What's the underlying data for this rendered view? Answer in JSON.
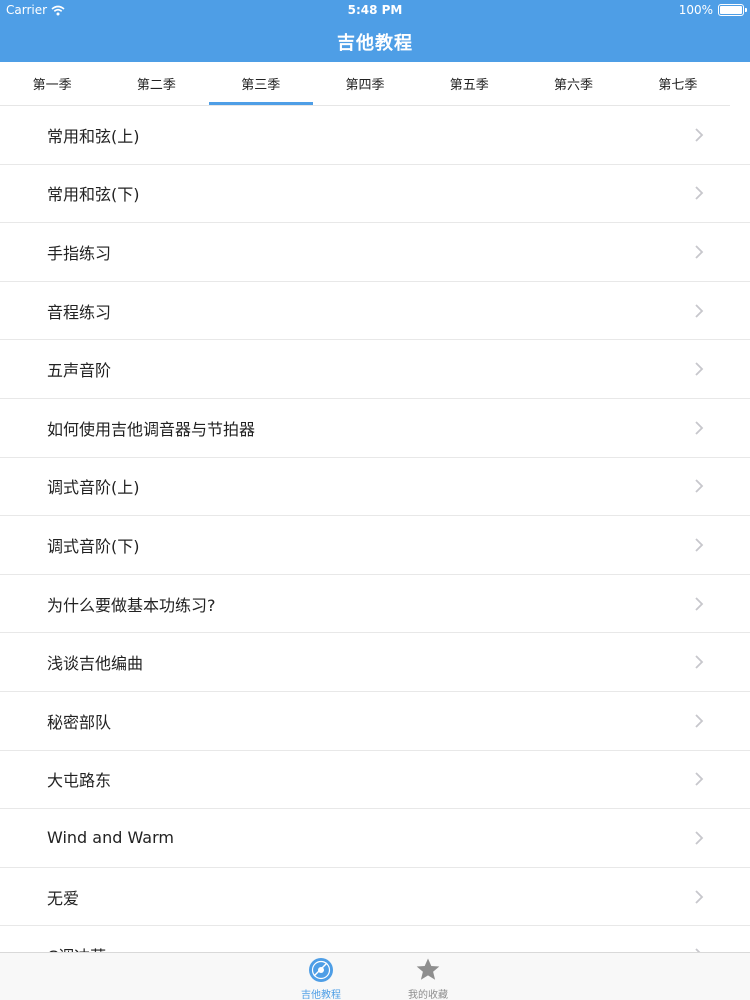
{
  "status_bar": {
    "carrier": "Carrier",
    "time": "5:48 PM",
    "battery": "100%",
    "battery_level": 1.0
  },
  "nav": {
    "title": "吉他教程"
  },
  "tabs": [
    {
      "label": "第一季",
      "active": false
    },
    {
      "label": "第二季",
      "active": false
    },
    {
      "label": "第三季",
      "active": true
    },
    {
      "label": "第四季",
      "active": false
    },
    {
      "label": "第五季",
      "active": false
    },
    {
      "label": "第六季",
      "active": false
    },
    {
      "label": "第七季",
      "active": false
    }
  ],
  "lessons": [
    "常用和弦(上)",
    "常用和弦(下)",
    "手指练习",
    "音程练习",
    "五声音阶",
    "如何使用吉他调音器与节拍器",
    "调式音阶(上)",
    "调式音阶(下)",
    "为什么要做基本功练习?",
    "浅谈吉他编曲",
    "秘密部队",
    "大屯路东",
    "Wind and Warm",
    "无爱",
    "C调冲菜"
  ],
  "tabbar": {
    "items": [
      {
        "label": "吉他教程",
        "icon": "disc-icon",
        "active": true
      },
      {
        "label": "我的收藏",
        "icon": "star-icon",
        "active": false
      }
    ]
  },
  "colors": {
    "accent": "#4e9ee6",
    "inactive": "#8e8e8e"
  }
}
